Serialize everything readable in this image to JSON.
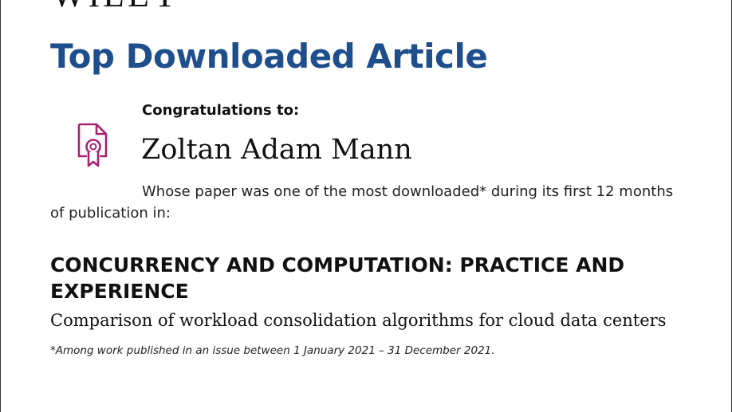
{
  "logo": {
    "text": "WILEY"
  },
  "certificate": {
    "title": "Top Downloaded Article",
    "congrats_label": "Congratulations to:",
    "recipient": "Zoltan Adam Mann",
    "description": "Whose paper was one of the most downloaded* during its first 12 months of publication in:",
    "journal": "CONCURRENCY AND COMPUTATION: PRACTICE AND EXPERIENCE",
    "paper_title": "Comparison of workload consolidation algorithms for cloud data centers",
    "footnote": "*Among work published in an issue between 1 January 2021 – 31 December 2021."
  },
  "icons": {
    "certificate": "certificate-icon"
  },
  "colors": {
    "title_blue": "#1f4e8c",
    "icon_magenta": "#a3256f",
    "text": "#111111"
  }
}
